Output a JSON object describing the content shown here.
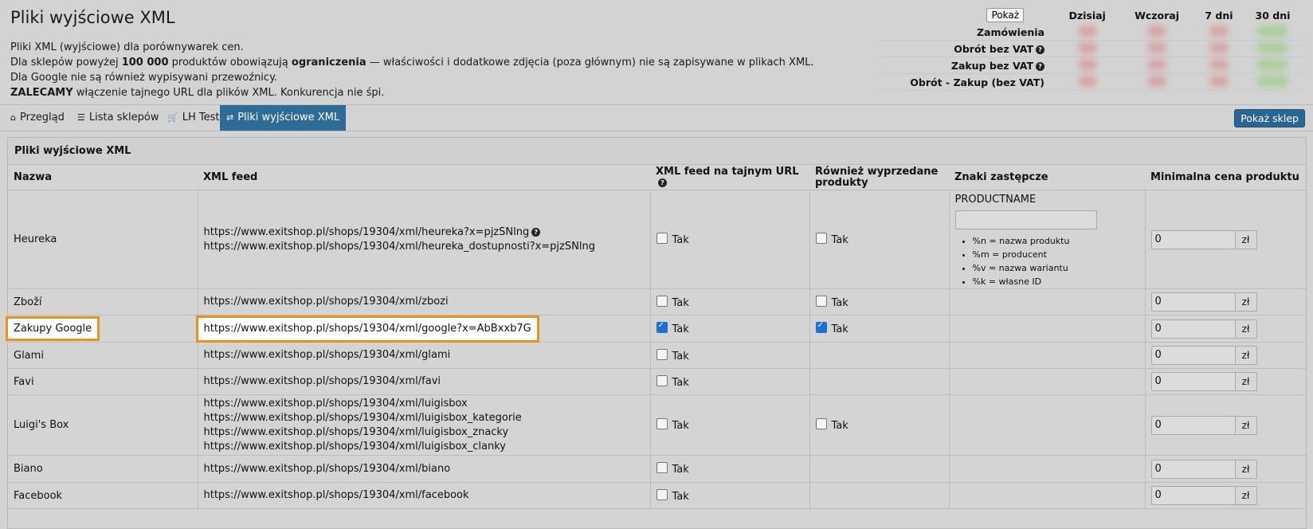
{
  "header": {
    "title": "Pliki wyjściowe XML",
    "intro": {
      "line1": "Pliki XML (wyjściowe) dla porównywarek cen.",
      "line2_a": "Dla sklepów powyżej ",
      "line2_b": "100 000",
      "line2_c": " produktów obowiązują ",
      "line2_d": "ograniczenia",
      "line2_e": " — właściwości i dodatkowe zdjęcia (poza głównym) nie są zapisywane w plikach XML.",
      "line3": "Dla Google nie są również wypisywani przewoźnicy.",
      "line4_a": "ZALECAMY",
      "line4_b": " włączenie tajnego URL dla plików XML. Konkurencja nie śpi."
    }
  },
  "stats": {
    "button": "Pokaż",
    "columns": [
      "Dzisiaj",
      "Wczoraj",
      "7 dni",
      "30 dni"
    ],
    "rows": [
      "Zamówienia",
      "Obrót bez VAT",
      "Zakup bez VAT",
      "Obrót - Zakup (bez VAT)"
    ]
  },
  "tabs": {
    "overview": "Przegląd",
    "shops": "Lista sklepów",
    "lhtest": "LH Test",
    "xml": "Pliki wyjściowe XML",
    "show_shop": "Pokaż sklep"
  },
  "panel": {
    "title": "Pliki wyjściowe XML",
    "columns": {
      "name": "Nazwa",
      "feed": "XML feed",
      "secret": "XML feed na tajnym URL",
      "soldout": "Również wyprzedane produkty",
      "placeholders": "Znaki zastępcze",
      "minprice": "Minimalna cena produktu"
    },
    "checkbox_label": "Tak",
    "currency": "zł",
    "placeholders": {
      "label": "PRODUCTNAME",
      "items": [
        "%n = nazwa produktu",
        "%m = producent",
        "%v = nazwa wariantu",
        "%k = własne ID"
      ]
    },
    "rows": [
      {
        "name": "Heureka",
        "urls": [
          "https://www.exitshop.pl/shops/19304/xml/heureka?x=pjzSNlng",
          "https://www.exitshop.pl/shops/19304/xml/heureka_dostupnosti?x=pjzSNlng"
        ],
        "secret": false,
        "soldout": false,
        "price": "0"
      },
      {
        "name": "Zboží",
        "urls": [
          "https://www.exitshop.pl/shops/19304/xml/zbozi"
        ],
        "secret": false,
        "soldout": false,
        "price": "0"
      },
      {
        "name": "Zakupy Google",
        "urls": [
          "https://www.exitshop.pl/shops/19304/xml/google?x=AbBxxb7G"
        ],
        "secret": true,
        "soldout": true,
        "price": "0"
      },
      {
        "name": "Glami",
        "urls": [
          "https://www.exitshop.pl/shops/19304/xml/glami"
        ],
        "secret": false,
        "soldout": null,
        "price": "0"
      },
      {
        "name": "Favi",
        "urls": [
          "https://www.exitshop.pl/shops/19304/xml/favi"
        ],
        "secret": false,
        "soldout": null,
        "price": "0"
      },
      {
        "name": "Luigi's Box",
        "urls": [
          "https://www.exitshop.pl/shops/19304/xml/luigisbox",
          "https://www.exitshop.pl/shops/19304/xml/luigisbox_kategorie",
          "https://www.exitshop.pl/shops/19304/xml/luigisbox_znacky",
          "https://www.exitshop.pl/shops/19304/xml/luigisbox_clanky"
        ],
        "secret": false,
        "soldout": false,
        "price": "0"
      },
      {
        "name": "Biano",
        "urls": [
          "https://www.exitshop.pl/shops/19304/xml/biano"
        ],
        "secret": false,
        "soldout": null,
        "price": "0"
      },
      {
        "name": "Facebook",
        "urls": [
          "https://www.exitshop.pl/shops/19304/xml/facebook"
        ],
        "secret": false,
        "soldout": null,
        "price": "0"
      }
    ]
  }
}
